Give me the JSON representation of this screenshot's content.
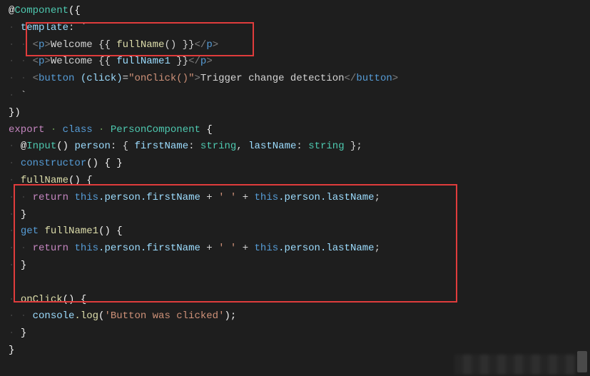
{
  "lines": {
    "l1_at": "@",
    "l1_dec": "Component",
    "l1_open": "({",
    "l2_prop": "template",
    "l2_colon": ": `",
    "l3_pre": "<p>",
    "l3_txt": "Welcome {{ ",
    "l3_fn": "fullName",
    "l3_args": "()",
    "l3_txt2": " }}",
    "l3_post": "</p>",
    "l4_pre": "<p>",
    "l4_txt": "Welcome {{ ",
    "l4_var": "fullName1",
    "l4_txt2": " }}",
    "l4_post": "</p>",
    "l5_tag": "button",
    "l5_event": "(click)",
    "l5_eq": "=",
    "l5_str": "\"onClick()\"",
    "l5_text": "Trigger change detection",
    "l7_close": "})",
    "l8_export": "export",
    "l8_class": "class",
    "l8_name": "PersonComponent",
    "l8_brace": "{",
    "l9_at": "@",
    "l9_dec": "Input",
    "l9_parens": "()",
    "l9_person": "person",
    "l9_c1": ": { ",
    "l9_fn": "firstName",
    "l9_c2": ": ",
    "l9_str1": "string",
    "l9_comma": ", ",
    "l9_ln": "lastName",
    "l9_c3": ": ",
    "l9_str2": "string",
    "l9_end": " };",
    "l10_ctor": "constructor",
    "l10_rest": "() { }",
    "l11_fn": "fullName",
    "l11_sig": "() {",
    "l12_return": "return",
    "l12_this": "this",
    "l12_person": ".person",
    "l12_fname": ".firstName",
    "l12_plus": " + ",
    "l12_str": "' '",
    "l12_lname": ".lastName",
    "l12_semi": ";",
    "l13_close": "}",
    "l14_get": "get",
    "l14_fn": "fullName1",
    "l14_sig": "() {",
    "l15_return": "return",
    "l16_close": "}",
    "l18_fn": "onClick",
    "l18_sig": "() {",
    "l19_console": "console",
    "l19_log": ".log",
    "l19_open": "(",
    "l19_str": "'Button was clicked'",
    "l19_close": ");",
    "l20_close": "}",
    "l21_close": "}"
  }
}
